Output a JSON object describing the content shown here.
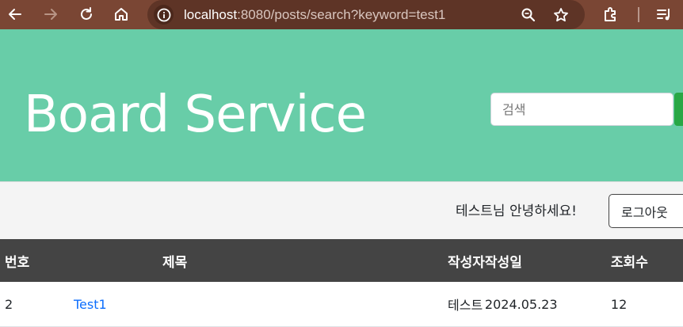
{
  "browser": {
    "url_host": "localhost",
    "url_rest": ":8080/posts/search?keyword=test1"
  },
  "header": {
    "brand": "Board Service",
    "search_placeholder": "검색"
  },
  "greeting_bar": {
    "greeting": "테스트님 안녕하세요!",
    "logout_label": "로그아웃"
  },
  "table": {
    "columns": [
      "번호",
      "제목",
      "작성자",
      "작성일",
      "조회수"
    ],
    "rows": [
      {
        "no": "2",
        "title": "Test1",
        "author": "테스트",
        "date": "2024.05.23",
        "views": "12"
      }
    ]
  },
  "colors": {
    "browser_bar": "#7a4634",
    "header_bg": "#68cda8",
    "table_header_bg": "#444444",
    "link": "#0d6efd",
    "search_button": "#28a745"
  },
  "icons": [
    "back-icon",
    "forward-icon",
    "reload-icon",
    "home-icon",
    "site-info-icon",
    "zoom-icon",
    "bookmark-star-icon",
    "extensions-icon",
    "reading-list-icon"
  ]
}
